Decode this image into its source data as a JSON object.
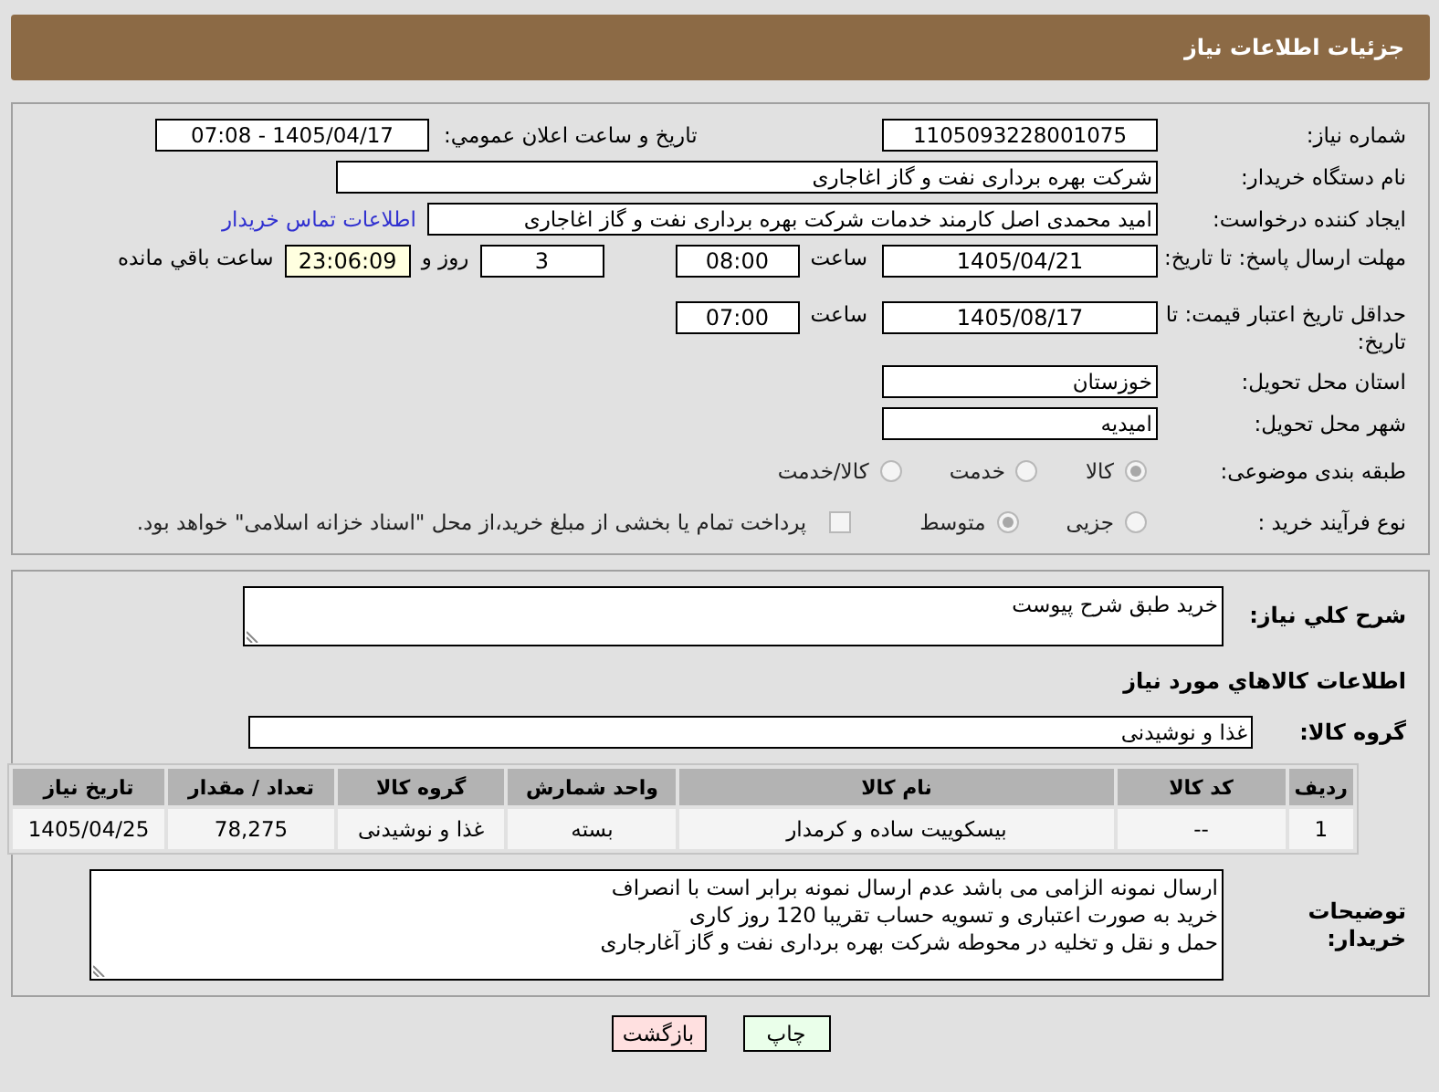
{
  "header": {
    "title": "جزئیات اطلاعات نیاز"
  },
  "need_number": {
    "label": "شماره نیاز:",
    "value": "1105093228001075"
  },
  "announce": {
    "label": "تاریخ و ساعت اعلان عمومي:",
    "value": "1405/04/17 - 07:08"
  },
  "buyer_org": {
    "label": "نام دستگاه خریدار:",
    "value": "شرکت بهره برداری نفت و گاز اغاجاری"
  },
  "requester": {
    "label": "ایجاد کننده درخواست:",
    "value": "امید محمدی اصل کارمند خدمات شرکت بهره برداری نفت و گاز اغاجاری",
    "link": "اطلاعات تماس خریدار"
  },
  "reply_deadline": {
    "label": "مهلت ارسال پاسخ: تا تاریخ:",
    "date": "1405/04/21",
    "time_label": "ساعت",
    "time": "08:00",
    "days": "3",
    "days_label": "روز و",
    "remaining": "23:06:09",
    "remaining_label": "ساعت باقي مانده"
  },
  "price_validity": {
    "label": "حداقل تاریخ اعتبار قیمت: تا تاریخ:",
    "date": "1405/08/17",
    "time_label": "ساعت",
    "time": "07:00"
  },
  "province": {
    "label": "استان محل تحویل:",
    "value": "خوزستان"
  },
  "city": {
    "label": "شهر محل تحویل:",
    "value": "امیدیه"
  },
  "category": {
    "label": "طبقه بندی موضوعی:",
    "options": [
      {
        "label": "کالا",
        "selected": true
      },
      {
        "label": "خدمت",
        "selected": false
      },
      {
        "label": "کالا/خدمت",
        "selected": false
      }
    ]
  },
  "process": {
    "label": "نوع فرآیند خرید :",
    "options": [
      {
        "label": "جزیی",
        "selected": false
      },
      {
        "label": "متوسط",
        "selected": true
      }
    ],
    "treasury": {
      "label": "پرداخت تمام یا بخشی از مبلغ خرید،از محل \"اسناد خزانه اسلامی\" خواهد بود.",
      "checked": false
    }
  },
  "description": {
    "label": "شرح کلي نیاز:",
    "value": "خرید طبق شرح پیوست"
  },
  "goods_title": "اطلاعات کالاهاي مورد نیاز",
  "goods_group": {
    "label": "گروه کالا:",
    "value": "غذا و نوشیدنی"
  },
  "table": {
    "columns": [
      "ردیف",
      "کد کالا",
      "نام کالا",
      "واحد شمارش",
      "گروه کالا",
      "تعداد / مقدار",
      "تاریخ نیاز"
    ],
    "rows": [
      [
        "1",
        "--",
        "بیسکوییت ساده و کرمدار",
        "بسته",
        "غذا و نوشیدنی",
        "78,275",
        "1405/04/25"
      ]
    ]
  },
  "buyer_notes": {
    "label": "توضیحات خریدار:",
    "lines": [
      "ارسال نمونه الزامی می باشد عدم ارسال نمونه برابر است با انصراف",
      "خرید به صورت اعتباری و تسویه حساب تقریبا  120 روز کاری",
      "حمل و نقل و تخلیه در محوطه  شرکت بهره برداری نفت و گاز آغارجاری"
    ]
  },
  "buttons": [
    {
      "label": "چاپ",
      "kind": "print"
    },
    {
      "label": "بازگشت",
      "kind": "back"
    }
  ]
}
